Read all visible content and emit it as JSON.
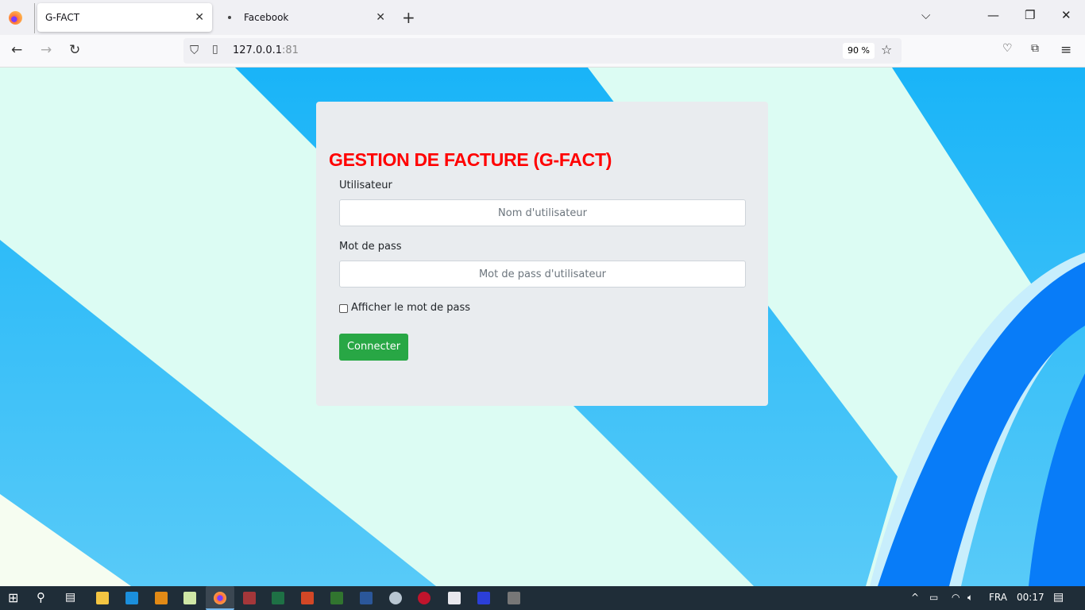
{
  "browser": {
    "tabs": [
      {
        "label": "G-FACT",
        "active": true
      },
      {
        "label": "Facebook",
        "active": false
      }
    ],
    "url_host": "127.0.0.1",
    "url_port": ":81",
    "zoom": "90 %"
  },
  "login": {
    "title": "GESTION DE FACTURE (G-FACT)",
    "user_label": "Utilisateur",
    "user_placeholder": "Nom d'utilisateur",
    "pass_label": "Mot de pass",
    "pass_placeholder": "Mot de pass d'utilisateur",
    "show_password_label": "Afficher le mot de pass",
    "submit_label": "Connecter"
  },
  "taskbar": {
    "apps": [
      "start",
      "search",
      "task-view",
      "file-explorer",
      "vscode",
      "sublime-text",
      "notepad",
      "firefox",
      "access",
      "excel",
      "powerpoint",
      "project",
      "word",
      "webcam",
      "app-red",
      "paint",
      "app-blue",
      "gimp"
    ],
    "language": "FRA",
    "time": "00:17"
  },
  "colors": {
    "title": "#ff0000",
    "button": "#28a745"
  }
}
